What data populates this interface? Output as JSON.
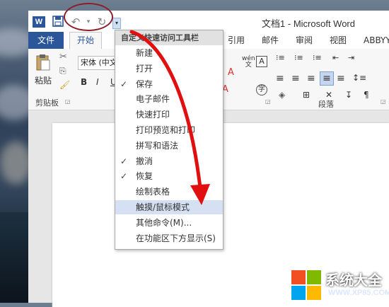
{
  "window": {
    "title": "文档1 - Microsoft Word",
    "app_icon": "W"
  },
  "qat": {
    "save_icon": "save-icon",
    "undo_icon": "undo-icon",
    "redo_icon": "redo-icon",
    "dropdown_icon": "chevron-down-icon"
  },
  "tabs": {
    "file": "文件",
    "home": "开始",
    "items": [
      "引用",
      "邮件",
      "审阅",
      "视图",
      "ABBYY"
    ]
  },
  "ribbon": {
    "paste_label": "粘贴",
    "clipboard_group": "剪贴板",
    "paragraph_group": "段落",
    "font_name": "宋体 (中文",
    "bold": "B",
    "italic": "I",
    "underline": "U",
    "wen_char": "wén"
  },
  "menu": {
    "header": "自定义快速访问工具栏",
    "items": [
      {
        "label": "新建",
        "checked": false,
        "highlighted": false
      },
      {
        "label": "打开",
        "checked": false,
        "highlighted": false
      },
      {
        "label": "保存",
        "checked": true,
        "highlighted": false
      },
      {
        "label": "电子邮件",
        "checked": false,
        "highlighted": false
      },
      {
        "label": "快速打印",
        "checked": false,
        "highlighted": false
      },
      {
        "label": "打印预览和打印",
        "checked": false,
        "highlighted": false
      },
      {
        "label": "拼写和语法",
        "checked": false,
        "highlighted": false
      },
      {
        "label": "撤消",
        "checked": true,
        "highlighted": false
      },
      {
        "label": "恢复",
        "checked": true,
        "highlighted": false
      },
      {
        "label": "绘制表格",
        "checked": false,
        "highlighted": false
      },
      {
        "label": "触摸/鼠标模式",
        "checked": false,
        "highlighted": true
      },
      {
        "label": "其他命令(M)...",
        "checked": false,
        "highlighted": false
      },
      {
        "label": "在功能区下方显示(S)",
        "checked": false,
        "highlighted": false
      }
    ]
  },
  "watermark": {
    "title": "系统大全",
    "url": "WWW.XP85.COM"
  },
  "colors": {
    "accent": "#2b579a",
    "annotation": "#e01010",
    "highlight": "#d5e1f2"
  }
}
